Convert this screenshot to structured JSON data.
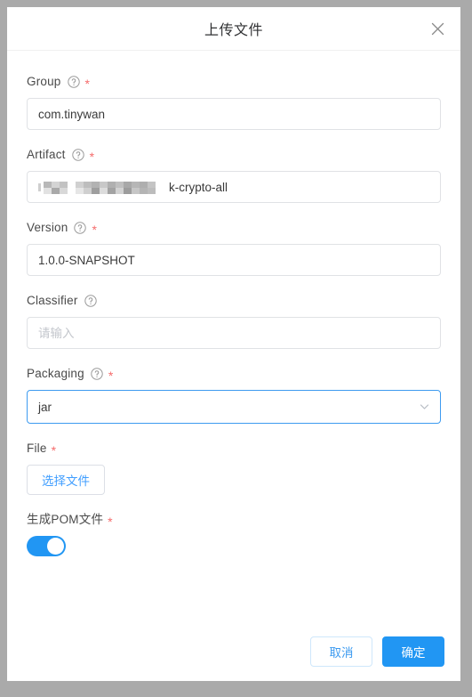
{
  "dialog": {
    "title": "上传文件",
    "close_icon": "close-icon"
  },
  "fields": {
    "group": {
      "label": "Group",
      "required_marker": "*",
      "help_icon": "help-circle-icon",
      "value": "com.tinywan",
      "placeholder": ""
    },
    "artifact": {
      "label": "Artifact",
      "required_marker": "*",
      "help_icon": "help-circle-icon",
      "value_masked": true,
      "value_visible_tail": "k-crypto-all",
      "placeholder": ""
    },
    "version": {
      "label": "Version",
      "required_marker": "*",
      "help_icon": "help-circle-icon",
      "value": "1.0.0-SNAPSHOT",
      "placeholder": ""
    },
    "classifier": {
      "label": "Classifier",
      "required_marker": "",
      "help_icon": "help-circle-icon",
      "value": "",
      "placeholder": "请输入"
    },
    "packaging": {
      "label": "Packaging",
      "required_marker": "*",
      "help_icon": "help-circle-icon",
      "selected": "jar",
      "options": [
        "jar"
      ],
      "dropdown_icon": "chevron-down-icon"
    },
    "file": {
      "label": "File",
      "required_marker": "*",
      "button_label": "选择文件"
    },
    "generate_pom": {
      "label": "生成POM文件",
      "required_marker": "*",
      "enabled": true
    }
  },
  "footer": {
    "cancel_label": "取消",
    "confirm_label": "确定"
  },
  "colors": {
    "accent": "#2196f3",
    "link": "#409eff",
    "required": "#f56c6c",
    "focus_border": "#3d9bf0",
    "page_backdrop": "#aaaaaa"
  }
}
